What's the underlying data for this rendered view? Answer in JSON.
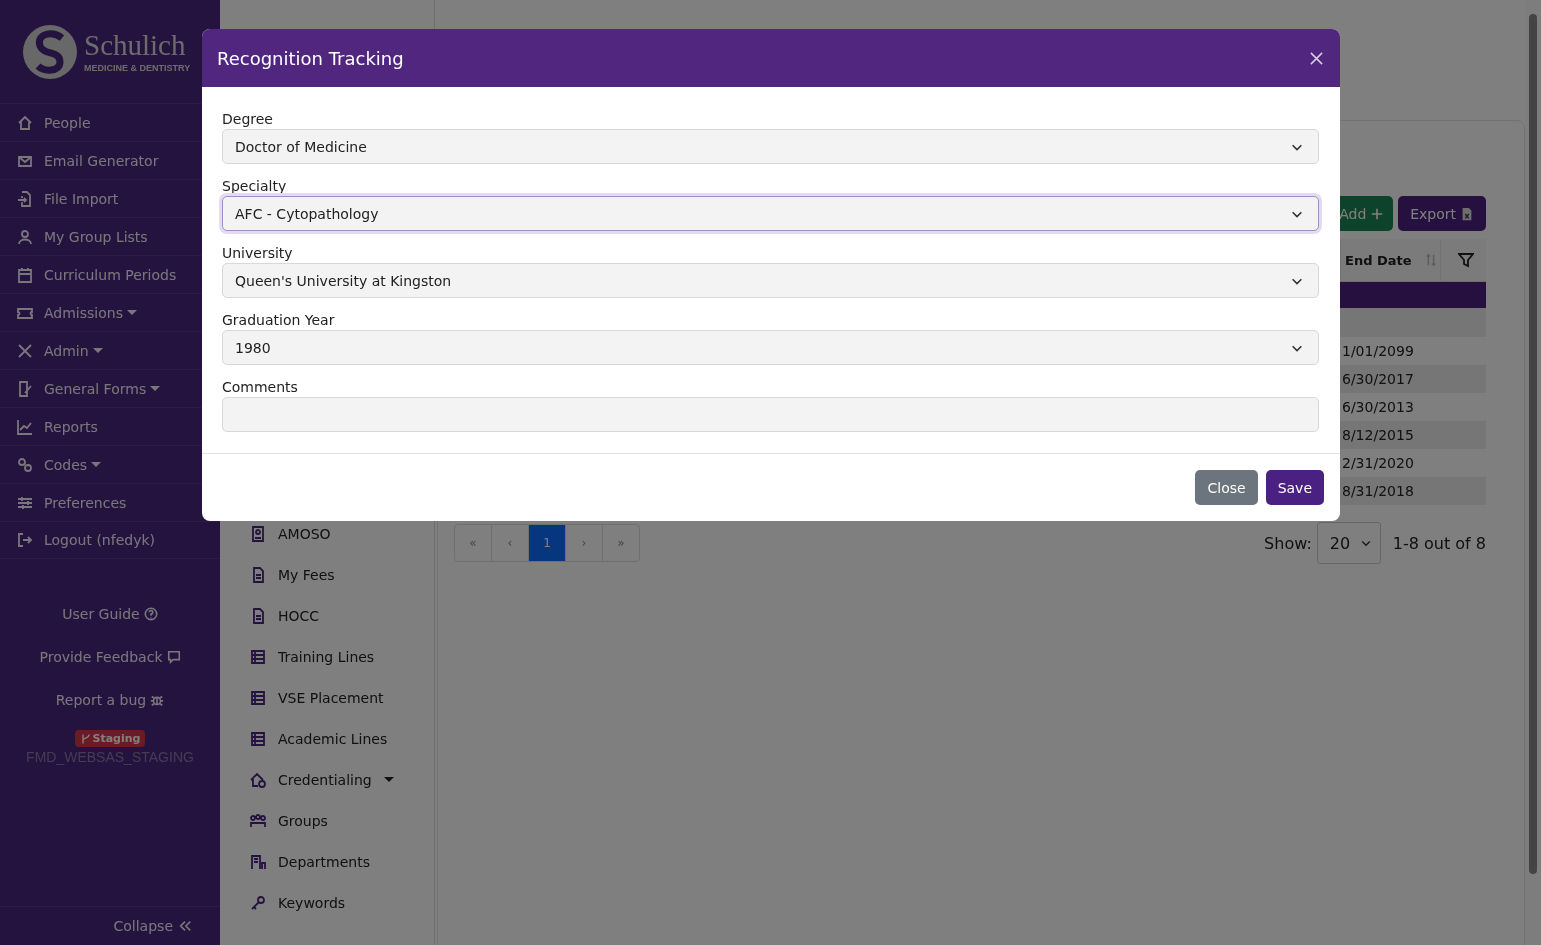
{
  "sidebar": {
    "logo": {
      "name": "Schulich",
      "tagline": "MEDICINE & DENTISTRY"
    },
    "items": [
      {
        "label": "People",
        "dropdown": false
      },
      {
        "label": "Email Generator",
        "dropdown": false
      },
      {
        "label": "File Import",
        "dropdown": false
      },
      {
        "label": "My Group Lists",
        "dropdown": false
      },
      {
        "label": "Curriculum Periods",
        "dropdown": false
      },
      {
        "label": "Admissions",
        "dropdown": true
      },
      {
        "label": "Admin",
        "dropdown": true
      },
      {
        "label": "General Forms",
        "dropdown": true
      },
      {
        "label": "Reports",
        "dropdown": false
      },
      {
        "label": "Codes",
        "dropdown": true
      },
      {
        "label": "Preferences",
        "dropdown": false
      },
      {
        "label": "Logout (nfedyk)",
        "dropdown": false
      }
    ],
    "links": [
      "User Guide",
      "Provide Feedback",
      "Report a bug"
    ],
    "badge": "Staging",
    "environment": "FMD_WEBSAS_STAGING",
    "collapse": "Collapse"
  },
  "subnav": {
    "items": [
      {
        "label": "AMOSO",
        "dropdown": false
      },
      {
        "label": "My Fees",
        "dropdown": false
      },
      {
        "label": "HOCC",
        "dropdown": false
      },
      {
        "label": "Training Lines",
        "dropdown": false
      },
      {
        "label": "VSE Placement",
        "dropdown": false
      },
      {
        "label": "Academic Lines",
        "dropdown": false
      },
      {
        "label": "Credentialing",
        "dropdown": true
      },
      {
        "label": "Groups",
        "dropdown": false
      },
      {
        "label": "Departments",
        "dropdown": false
      },
      {
        "label": "Keywords",
        "dropdown": false
      }
    ]
  },
  "toolbar": {
    "add": "Add",
    "export": "Export"
  },
  "table": {
    "columns": [
      {
        "label": "End Date"
      }
    ],
    "rows": [
      {
        "end_date": "1/01/2099"
      },
      {
        "end_date": "6/30/2017"
      },
      {
        "end_date": "6/30/2013"
      },
      {
        "end_date": "8/12/2015"
      },
      {
        "end_date": "2/31/2020"
      },
      {
        "end_date": "8/31/2018"
      }
    ]
  },
  "pagination": {
    "pages": [
      {
        "label": "«",
        "selected": false
      },
      {
        "label": "‹",
        "selected": false
      },
      {
        "label": "1",
        "selected": true
      },
      {
        "label": "›",
        "selected": false
      },
      {
        "label": "»",
        "selected": false
      }
    ],
    "show_label": "Show:",
    "page_size": "20",
    "range": "1-8 out of 8"
  },
  "modal": {
    "title": "Recognition Tracking",
    "fields": [
      {
        "label": "Degree",
        "kind": "select",
        "value": "Doctor of Medicine",
        "focused": false
      },
      {
        "label": "Specialty",
        "kind": "select",
        "value": "AFC - Cytopathology",
        "focused": true
      },
      {
        "label": "University",
        "kind": "select",
        "value": "Queen's University at Kingston",
        "focused": false
      },
      {
        "label": "Graduation Year",
        "kind": "select",
        "value": "1980",
        "focused": false
      },
      {
        "label": "Comments",
        "kind": "textarea",
        "focused": false
      }
    ],
    "buttons": [
      {
        "label": "Close",
        "kind": "secondary"
      },
      {
        "label": "Save",
        "kind": "primary"
      }
    ]
  }
}
